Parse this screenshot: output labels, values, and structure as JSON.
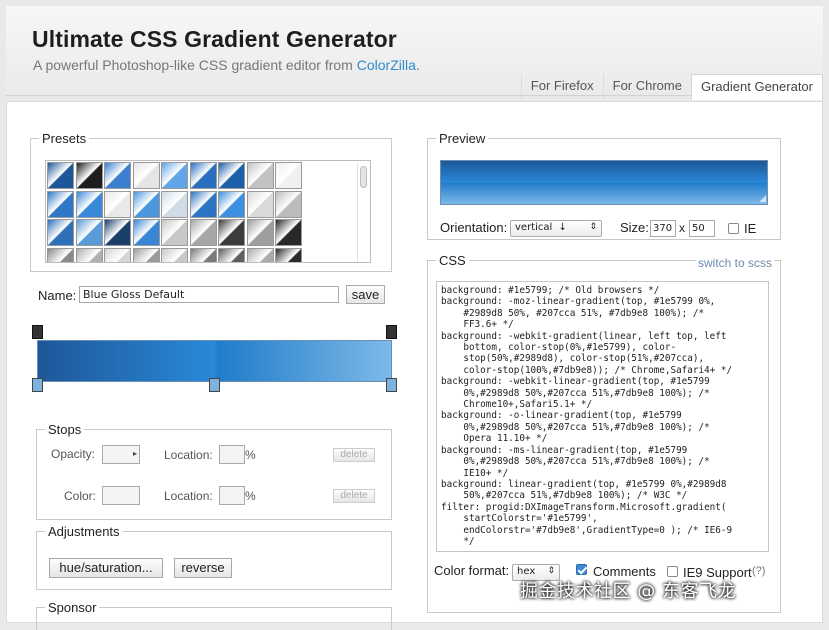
{
  "header": {
    "title": "Ultimate CSS Gradient Generator",
    "subtitle_prefix": "A powerful Photoshop-like CSS gradient editor from ",
    "subtitle_link": "ColorZilla",
    "subtitle_suffix": ".",
    "nav": [
      "For Firefox",
      "For Chrome",
      "Gradient Generator"
    ]
  },
  "presets": {
    "legend": "Presets",
    "swatch_colors": [
      [
        "#1e5799",
        "#1e1e1e",
        "#3b7fd0",
        "#e5e5e5",
        "#5fa5e8",
        "#2a6fbf",
        "#1d5fa8",
        "#c2c2c2",
        "#f0f0f0"
      ],
      [
        "#2f78c8",
        "#3a88d8",
        "#e9e9e9",
        "#4b97dd",
        "#cfdce8",
        "#2b74c4",
        "#3d8fe0",
        "#dadada",
        "#bcbcbc"
      ],
      [
        "#2e6fb8",
        "#5a9ad6",
        "#1a3f6a",
        "#3a86d6",
        "#c7c7c7",
        "#a6a6a6",
        "#3b3b3b",
        "#9e9e9e",
        "#282828"
      ],
      [
        "#8a8a8a",
        "#b0b0b0",
        "#d6d6d6",
        "#9b9b9b",
        "#c8c8c8",
        "#7a7a7a",
        "#5e5e5e",
        "#ababab",
        "#2a2a2a"
      ]
    ]
  },
  "name_field": {
    "label": "Name:",
    "value": "Blue Gloss Default",
    "save_label": "save"
  },
  "stops": {
    "legend": "Stops",
    "opacity_label": "Opacity:",
    "location_label": "Location:",
    "percent": "%",
    "color_label": "Color:",
    "delete_label": "delete"
  },
  "adjustments": {
    "legend": "Adjustments",
    "hue_label": "hue/saturation...",
    "reverse_label": "reverse"
  },
  "sponsor": {
    "legend": "Sponsor"
  },
  "preview": {
    "legend": "Preview",
    "orientation_label": "Orientation:",
    "orientation_value": "vertical",
    "orientation_arrow": "↓",
    "size_label": "Size:",
    "width": "370",
    "times": "x",
    "height": "50",
    "ie_label": "IE"
  },
  "css": {
    "legend": "CSS",
    "switch_label": "switch to scss",
    "code": "background: #1e5799; /* Old browsers */\nbackground: -moz-linear-gradient(top, #1e5799 0%,\n    #2989d8 50%, #207cca 51%, #7db9e8 100%); /*\n    FF3.6+ */\nbackground: -webkit-gradient(linear, left top, left\n    bottom, color-stop(0%,#1e5799), color-\n    stop(50%,#2989d8), color-stop(51%,#207cca),\n    color-stop(100%,#7db9e8)); /* Chrome,Safari4+ */\nbackground: -webkit-linear-gradient(top, #1e5799\n    0%,#2989d8 50%,#207cca 51%,#7db9e8 100%); /*\n    Chrome10+,Safari5.1+ */\nbackground: -o-linear-gradient(top, #1e5799\n    0%,#2989d8 50%,#207cca 51%,#7db9e8 100%); /*\n    Opera 11.10+ */\nbackground: -ms-linear-gradient(top, #1e5799\n    0%,#2989d8 50%,#207cca 51%,#7db9e8 100%); /*\n    IE10+ */\nbackground: linear-gradient(top, #1e5799 0%,#2989d8\n    50%,#207cca 51%,#7db9e8 100%); /* W3C */\nfilter: progid:DXImageTransform.Microsoft.gradient(\n    startColorstr='#1e5799',\n    endColorstr='#7db9e8',GradientType=0 ); /* IE6-9\n    */",
    "color_format_label": "Color format:",
    "color_format_value": "hex",
    "comments_label": "Comments",
    "ie9_label": "IE9 Support",
    "help_label": "(?)"
  },
  "watermark": "掘金技术社区 @ 东客飞龙",
  "colors": {
    "accent": "#2f8bc9",
    "gradient_stops": [
      "#1e5799",
      "#2989d8",
      "#207cca",
      "#7db9e8"
    ]
  }
}
